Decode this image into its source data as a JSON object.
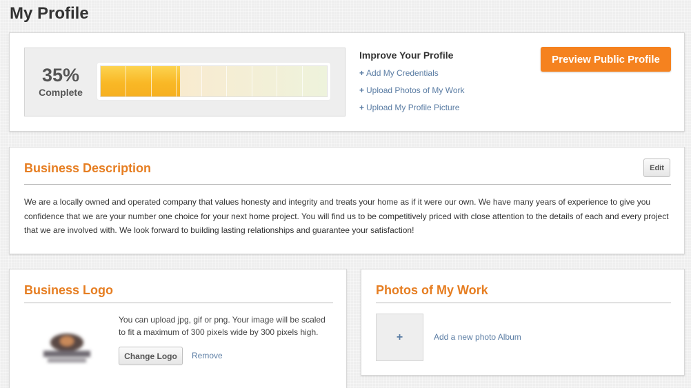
{
  "page": {
    "title": "My Profile"
  },
  "progress": {
    "percent_text": "35%",
    "complete_label": "Complete",
    "value": 0.35,
    "fill_color": "#f9b826",
    "improve_title": "Improve Your Profile",
    "links": [
      "Add My Credentials",
      "Upload Photos of My Work",
      "Upload My Profile Picture"
    ],
    "link_prefix": "+",
    "preview_button": "Preview Public Profile",
    "accent_color": "#f5821f"
  },
  "business_description": {
    "title": "Business Description",
    "edit_label": "Edit",
    "text": "We are a locally owned and operated company that values honesty and integrity and treats your home as if it were our own. We have many years of experience to give you confidence that we are your number one choice for your next home project. You will find us to be competitively priced with close attention to the details of each and every project that we are involved with. We look forward to building lasting relationships and guarantee your satisfaction!"
  },
  "business_logo": {
    "title": "Business Logo",
    "help_text": "You can upload jpg, gif or png. Your image will be scaled to fit a maximum of 300 pixels wide by 300 pixels high.",
    "change_button": "Change Logo",
    "remove_label": "Remove",
    "logo_icon": "company-logo-image"
  },
  "photos": {
    "title": "Photos of My Work",
    "add_symbol": "+",
    "add_album_label": "Add a new photo Album"
  }
}
